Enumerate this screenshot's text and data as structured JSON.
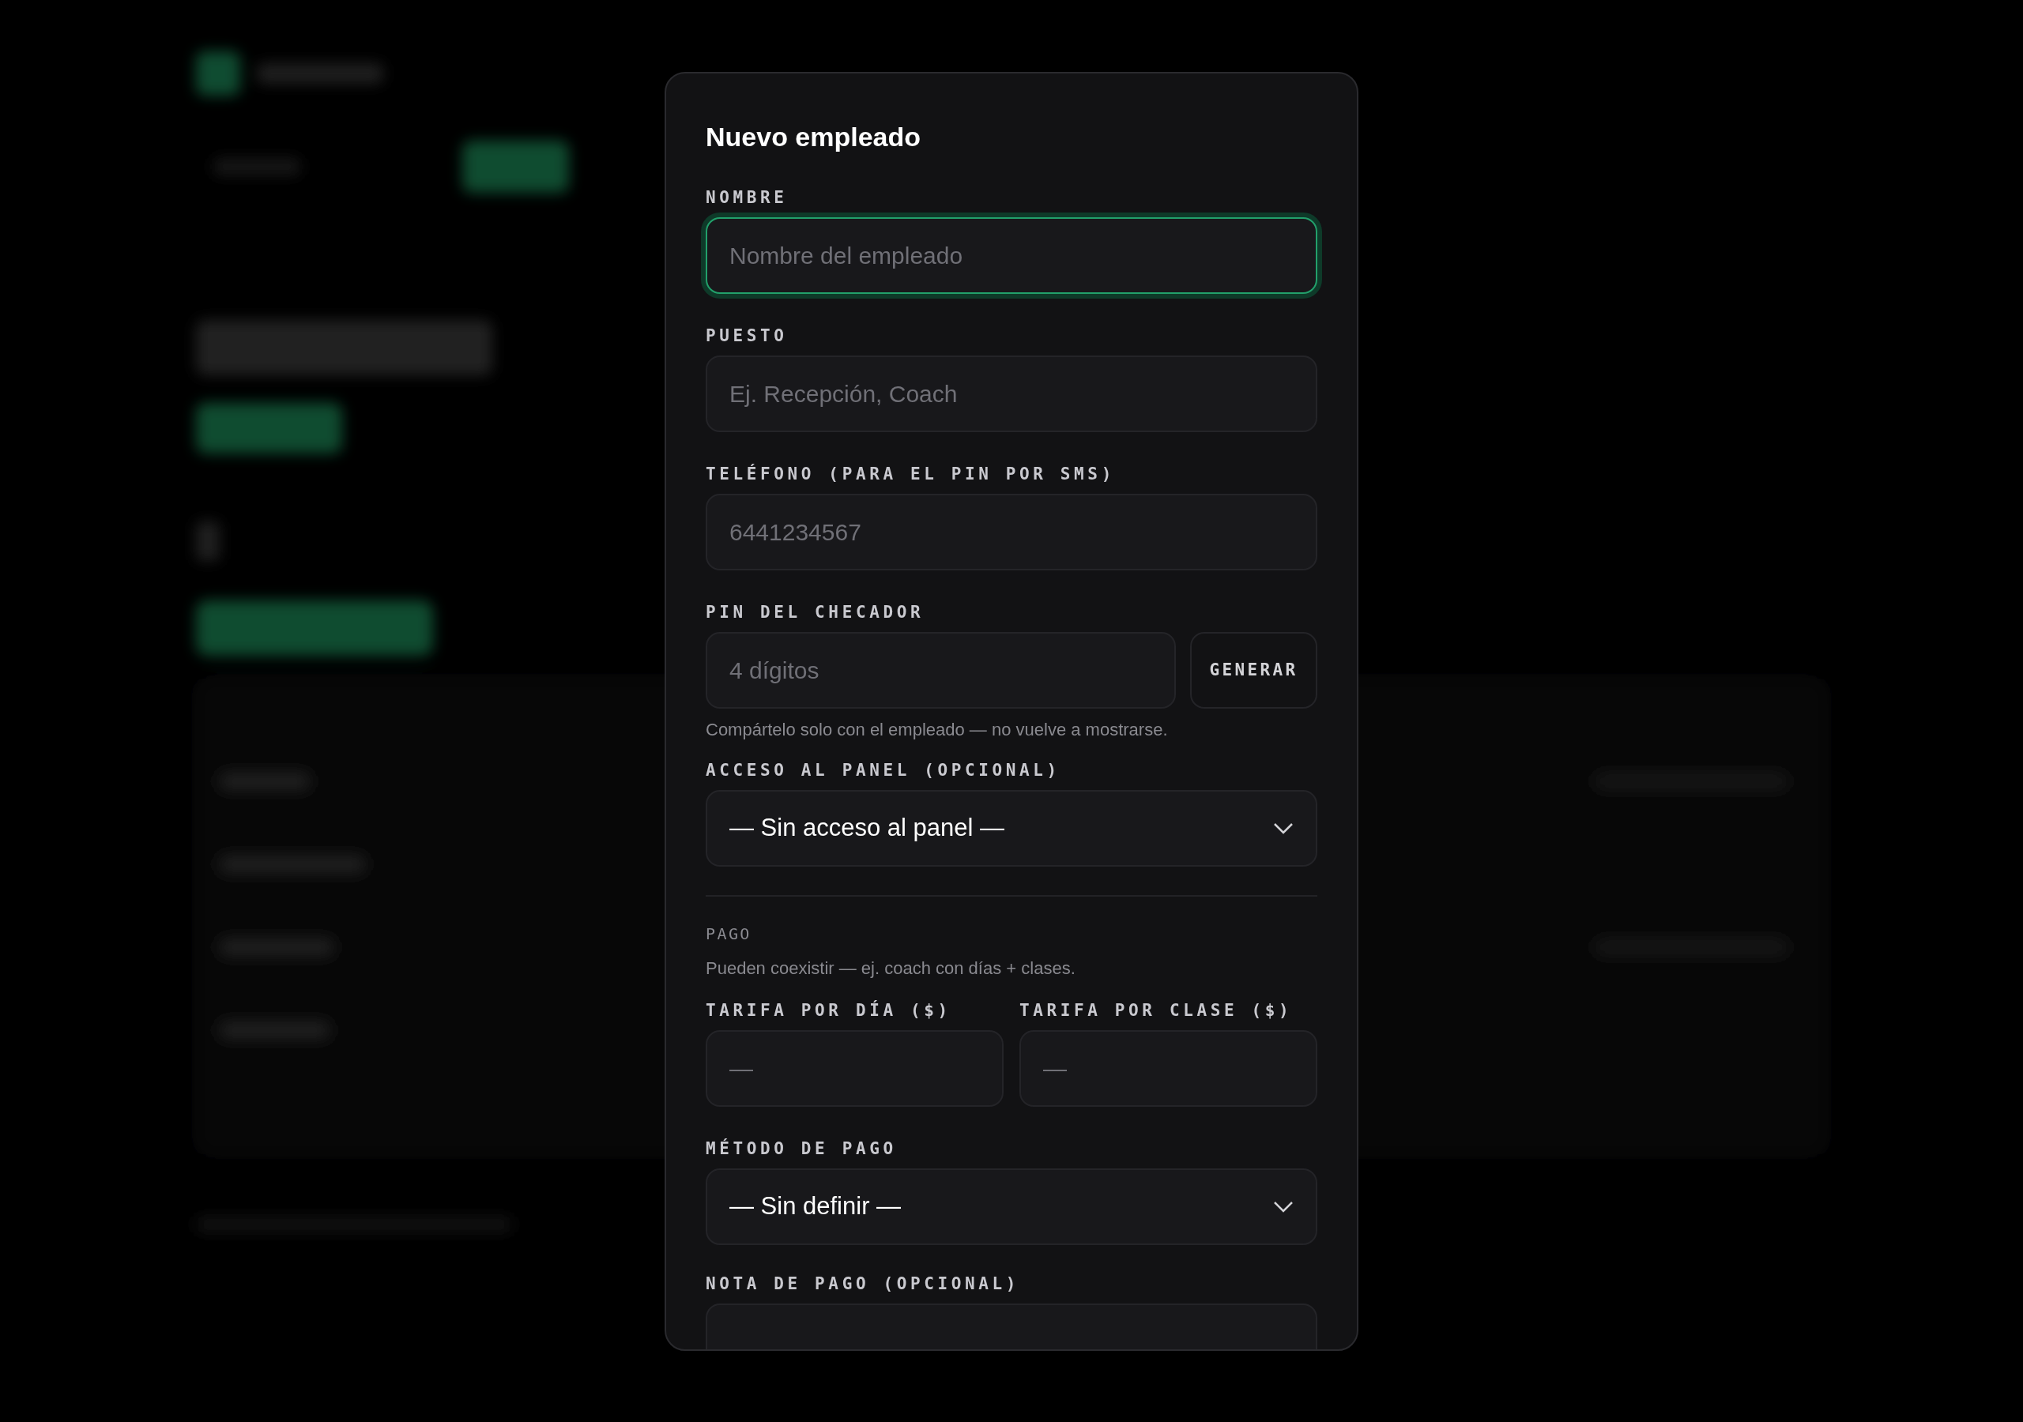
{
  "dialog": {
    "title": "Nuevo empleado",
    "fields": [
      {
        "kind": "text",
        "label": "NOMBRE",
        "placeholder": "Nombre del empleado",
        "focused": true
      },
      {
        "kind": "text",
        "label": "PUESTO",
        "placeholder": "Ej. Recepción, Coach",
        "focused": false
      },
      {
        "kind": "text",
        "label": "TELÉFONO (PARA EL PIN POR SMS)",
        "placeholder": "6441234567",
        "focused": false
      },
      {
        "kind": "pin",
        "label": "PIN DEL CHECADOR",
        "placeholder": "4 dígitos",
        "button": "GENERAR",
        "hint": "Compártelo solo con el empleado — no vuelve a mostrarse.",
        "focused": false
      },
      {
        "kind": "select",
        "label": "ACCESO AL PANEL (OPCIONAL)",
        "value": "— Sin acceso al panel —"
      },
      {
        "kind": "section",
        "label": "PAGO",
        "note": "Pueden coexistir — ej. coach con días + clases."
      },
      {
        "kind": "pair",
        "fields": [
          {
            "label": "TARIFA POR DÍA ($)",
            "placeholder": "—",
            "focused": false
          },
          {
            "label": "TARIFA POR CLASE ($)",
            "placeholder": "—",
            "focused": false
          }
        ]
      },
      {
        "kind": "select",
        "label": "MÉTODO DE PAGO",
        "value": "— Sin definir —"
      },
      {
        "kind": "text",
        "label": "NOTA DE PAGO (OPCIONAL)"
      }
    ]
  }
}
